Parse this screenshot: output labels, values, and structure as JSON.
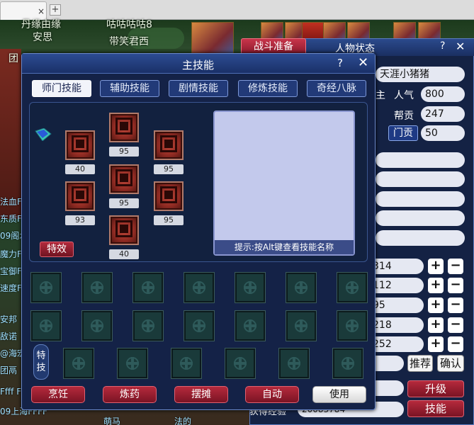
{
  "browser": {
    "tab_close": "×",
    "new_tab": "+"
  },
  "scene": {
    "top_names": [
      "丹缘由缘",
      "安思",
      "咕咕咕咕8",
      "带笑君西",
      "团"
    ],
    "left_texts": [
      "法血F",
      "东质F",
      "09阁木",
      "魔力F",
      "宝御F",
      "速度F",
      "安邦",
      "敌诺",
      "@海宏",
      "团鬲",
      "Ffff FFF",
      "09上海FFFF",
      "萌马",
      "法的"
    ]
  },
  "status_panel": {
    "battle_ready": "战斗准备",
    "title": "人物状态",
    "help": "?",
    "close": "✕",
    "name": "天涯小猪猪",
    "label_rank": "主",
    "label_popularity": "人气",
    "popularity": "800",
    "label_contribution": "帮贡",
    "contribution": "247",
    "label_sect_contribution": "门贡",
    "sect_contribution": "50",
    "attr_values": [
      "314",
      "112",
      "95",
      "218",
      "252"
    ],
    "plus": "+",
    "minus": "−",
    "recommend": "推荐",
    "confirm": "确认",
    "upgrade": "升级",
    "skills": "技能",
    "exp_label": "获得经验",
    "exp_value": "20083784"
  },
  "dialog": {
    "title": "主技能",
    "help": "?",
    "close": "✕",
    "tabs": [
      "师门技能",
      "辅助技能",
      "剧情技能",
      "修炼技能",
      "奇经八脉"
    ],
    "skill_levels": [
      "95",
      "40",
      "95",
      "95",
      "93",
      "95",
      "40"
    ],
    "effect_button": "特效",
    "hint": "提示:按Alt键查看技能名称",
    "special_label": "特技",
    "bottom_buttons": [
      "烹饪",
      "炼药",
      "摆摊",
      "自动",
      "使用"
    ]
  },
  "colors": {
    "panel_bg": "#142247",
    "accent_red": "#b52a3c",
    "desc_bg": "#c3c9ec"
  }
}
